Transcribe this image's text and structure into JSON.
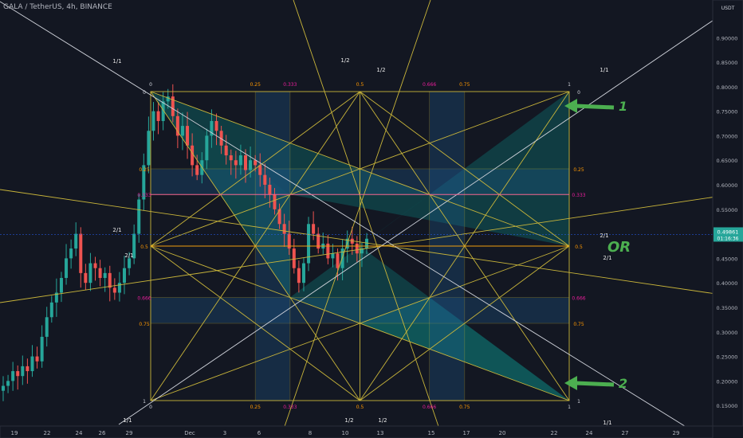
{
  "header": {
    "symbol": "GALA / TetherUS, 4h, BINANCE"
  },
  "y_axis": {
    "currency": "USDT",
    "ticks": [
      "0.90000",
      "0.85000",
      "0.80000",
      "0.75000",
      "0.70000",
      "0.65000",
      "0.60000",
      "0.55000",
      "0.50000",
      "0.45000",
      "0.40000",
      "0.35000",
      "0.30000",
      "0.25000",
      "0.20000",
      "0.15000"
    ],
    "last_price": "0.49861",
    "countdown": "01:16:36"
  },
  "x_axis": {
    "ticks": [
      "19",
      "22",
      "24",
      "26",
      "29",
      "Dec",
      "3",
      "6",
      "8",
      "10",
      "13",
      "15",
      "17",
      "20",
      "22",
      "24",
      "27",
      "29"
    ]
  },
  "annotations": {
    "arrow1": "1",
    "arrow2": "2",
    "or": "OR"
  },
  "gann": {
    "top_labels": [
      "0",
      "0.25",
      "0.333",
      "0.5",
      "0.666",
      "0.75",
      "1"
    ],
    "bottom_labels": [
      "0",
      "0.25",
      "0.333",
      "0.5",
      "0.666",
      "0.75",
      "1"
    ],
    "left_labels": [
      "0",
      "0.25",
      "0.333",
      "0.5",
      "0.666",
      "0.75",
      "1"
    ],
    "right_labels": [
      "0",
      "0.25",
      "0.333",
      "0.5",
      "0.666",
      "0.75",
      "1"
    ],
    "angle_labels": [
      "1/1",
      "1/2",
      "1/2",
      "1/1",
      "2/1",
      "2/1",
      "2/1",
      "2/1",
      "1/1",
      "1/2",
      "1/2",
      "1/1"
    ],
    "colors": {
      "line": "#c9b53a",
      "pink": "#e91e9b",
      "orange": "#ff9800",
      "white": "#d1d4dc",
      "fill": "#1e5a8c",
      "teal": "#0e6a6a"
    }
  },
  "chart_data": {
    "type": "candlestick",
    "title": "GALA / TetherUS, 4h, BINANCE",
    "ylim": [
      0.13,
      0.95
    ],
    "x_ticks": [
      "19",
      "22",
      "24",
      "26",
      "29",
      "Dec",
      "3",
      "6",
      "8",
      "10",
      "13",
      "15",
      "17",
      "20",
      "22",
      "24",
      "27",
      "29"
    ],
    "last_price": 0.49861,
    "gann_box": {
      "top_price": 0.79,
      "bottom_price": 0.16,
      "start_label": "0",
      "end_label": "1"
    },
    "close_path": [
      0.19,
      0.2,
      0.22,
      0.21,
      0.23,
      0.22,
      0.25,
      0.24,
      0.29,
      0.33,
      0.36,
      0.38,
      0.41,
      0.45,
      0.47,
      0.5,
      0.42,
      0.4,
      0.44,
      0.43,
      0.41,
      0.42,
      0.39,
      0.38,
      0.4,
      0.43,
      0.45,
      0.5,
      0.57,
      0.64,
      0.71,
      0.75,
      0.73,
      0.77,
      0.78,
      0.74,
      0.7,
      0.72,
      0.68,
      0.64,
      0.62,
      0.65,
      0.7,
      0.73,
      0.71,
      0.68,
      0.66,
      0.65,
      0.64,
      0.66,
      0.63,
      0.65,
      0.64,
      0.62,
      0.6,
      0.58,
      0.55,
      0.52,
      0.5,
      0.47,
      0.43,
      0.4,
      0.44,
      0.52,
      0.5,
      0.47,
      0.48,
      0.45,
      0.46,
      0.43,
      0.47,
      0.49,
      0.48,
      0.46,
      0.47,
      0.49
    ]
  }
}
